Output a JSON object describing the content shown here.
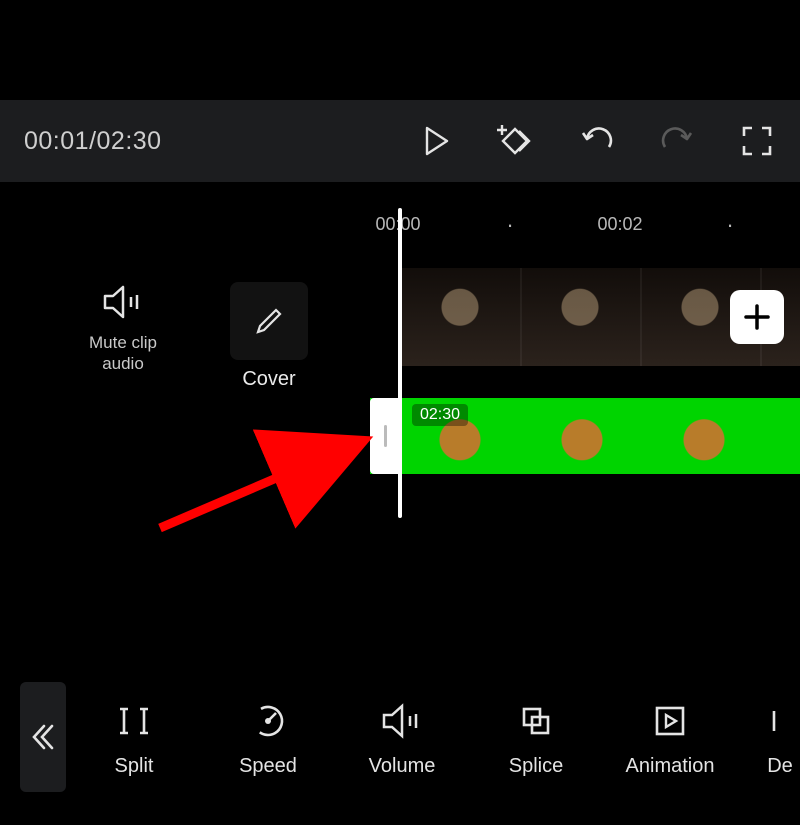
{
  "topbar": {
    "current_time": "00:01",
    "total_time": "02:30",
    "separator": "/"
  },
  "ruler": {
    "tick1": "00:00",
    "tick2": "00:02"
  },
  "side": {
    "mute_label": "Mute clip\naudio",
    "cover_label": "Cover"
  },
  "track2": {
    "duration": "02:30"
  },
  "tools": {
    "split": "Split",
    "speed": "Speed",
    "volume": "Volume",
    "splice": "Splice",
    "animation": "Animation",
    "delete_partial": "De"
  },
  "icons": {
    "play": "play-icon",
    "keyframe": "add-keyframe-icon",
    "undo": "undo-icon",
    "redo": "redo-icon",
    "fullscreen": "fullscreen-icon",
    "mute": "speaker-icon",
    "pencil": "pencil-icon",
    "add": "plus-icon",
    "back": "chevron-left-double-icon",
    "split": "split-icon",
    "speed": "speed-dial-icon",
    "volume": "volume-icon",
    "splice": "splice-icon",
    "animation": "animation-play-icon"
  }
}
